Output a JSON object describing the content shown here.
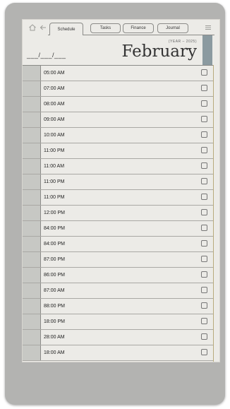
{
  "tabs": [
    {
      "label": "Schedule",
      "active": true
    },
    {
      "label": "Tasks",
      "active": false
    },
    {
      "label": "Finance",
      "active": false
    },
    {
      "label": "Journal",
      "active": false
    }
  ],
  "header": {
    "date_placeholder": "___/___/___",
    "year_label": "(YEAR – 2025)",
    "month": "February"
  },
  "icons": {
    "home": "home-icon",
    "back": "back-arrow-icon",
    "menu": "menu-icon"
  },
  "colors": {
    "screen_bg": "#ecebe7",
    "accent": "#8b9aa0",
    "row_strip": "#c7c8c4"
  },
  "schedule": {
    "rows": [
      {
        "time": "05:00 AM",
        "checked": false
      },
      {
        "time": "07:00 AM",
        "checked": false
      },
      {
        "time": "08:00 AM",
        "checked": false
      },
      {
        "time": "09:00 AM",
        "checked": false
      },
      {
        "time": "10:00 AM",
        "checked": false
      },
      {
        "time": "11:00 PM",
        "checked": false
      },
      {
        "time": "11:00 AM",
        "checked": false
      },
      {
        "time": "11:00 PM",
        "checked": false
      },
      {
        "time": "11:00 PM",
        "checked": false
      },
      {
        "time": "12:00 PM",
        "checked": false
      },
      {
        "time": "84:00 PM",
        "checked": false
      },
      {
        "time": "84:00 PM",
        "checked": false
      },
      {
        "time": "87:00 PM",
        "checked": false
      },
      {
        "time": "86:00 PM",
        "checked": false
      },
      {
        "time": "87:00 AM",
        "checked": false
      },
      {
        "time": "88:00 PM",
        "checked": false
      },
      {
        "time": "18:00 PM",
        "checked": false
      },
      {
        "time": "28:00 AM",
        "checked": false
      },
      {
        "time": "18:00 AM",
        "checked": false
      }
    ]
  }
}
